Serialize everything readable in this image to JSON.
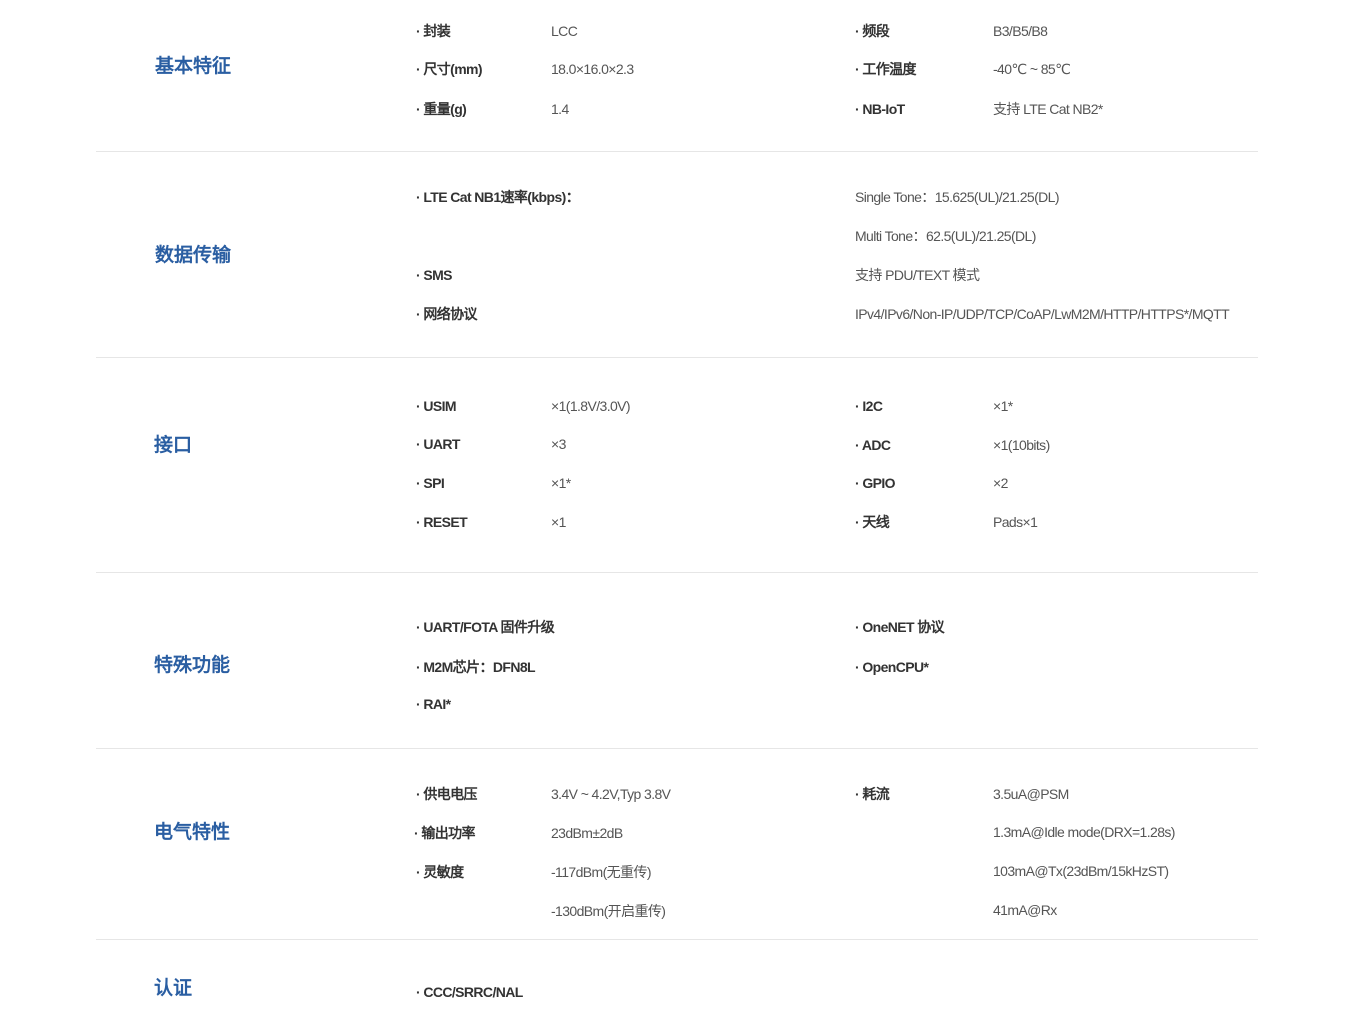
{
  "sections": {
    "basic": {
      "title": "基本特征",
      "package_label": "· 封装",
      "package_value": "LCC",
      "size_label": "· 尺寸(mm)",
      "size_value": "18.0×16.0×2.3",
      "weight_label": "· 重量(g)",
      "weight_value": "1.4",
      "band_label": "· 频段",
      "band_value": "B3/B5/B8",
      "temp_label": "· 工作温度",
      "temp_value": "-40℃ ~ 85℃",
      "nbiot_label": "· NB-IoT",
      "nbiot_value": "支持 LTE Cat NB2*"
    },
    "data": {
      "title": "数据传输",
      "rate_label": "· LTE Cat NB1速率(kbps)：",
      "rate_single": "Single Tone：15.625(UL)/21.25(DL)",
      "rate_multi": "Multi Tone：62.5(UL)/21.25(DL)",
      "sms_label": "· SMS",
      "sms_value": "支持 PDU/TEXT 模式",
      "protocol_label": "· 网络协议",
      "protocol_value": "IPv4/IPv6/Non-IP/UDP/TCP/CoAP/LwM2M/HTTP/HTTPS*/MQTT"
    },
    "interface": {
      "title": "接口",
      "usim_label": "· USIM",
      "usim_value": "×1(1.8V/3.0V)",
      "uart_label": "· UART",
      "uart_value": "×3",
      "spi_label": "· SPI",
      "spi_value": "×1*",
      "reset_label": "· RESET",
      "reset_value": "×1",
      "i2c_label": "· I2C",
      "i2c_value": "×1*",
      "adc_label": "· ADC",
      "adc_value": "×1(10bits)",
      "gpio_label": "· GPIO",
      "gpio_value": "×2",
      "antenna_label": "· 天线",
      "antenna_value": "Pads×1"
    },
    "special": {
      "title": "特殊功能",
      "item1": "· UART/FOTA 固件升级",
      "item2": "· M2M芯片：DFN8L",
      "item3": "· RAI*",
      "item4": "· OneNET 协议",
      "item5": "· OpenCPU*"
    },
    "electrical": {
      "title": "电气特性",
      "voltage_label": "· 供电电压",
      "voltage_value": "3.4V ~ 4.2V,Typ 3.8V",
      "power_label": "· 输出功率",
      "power_value": "23dBm±2dB",
      "sensitivity_label": "· 灵敏度",
      "sensitivity_value_1": "-117dBm(无重传)",
      "sensitivity_value_2": "-130dBm(开启重传)",
      "current_label": "· 耗流",
      "current_value_1": "3.5uA@PSM",
      "current_value_2": "1.3mA@Idle mode(DRX=1.28s)",
      "current_value_3": "103mA@Tx(23dBm/15kHzST)",
      "current_value_4": "41mA@Rx"
    },
    "cert": {
      "title": "认证",
      "value": "· CCC/SRRC/NAL"
    }
  },
  "colors": {
    "heading": "#2a5ea2",
    "label": "#333333",
    "value": "#555555",
    "divider": "#e6e6e6"
  }
}
